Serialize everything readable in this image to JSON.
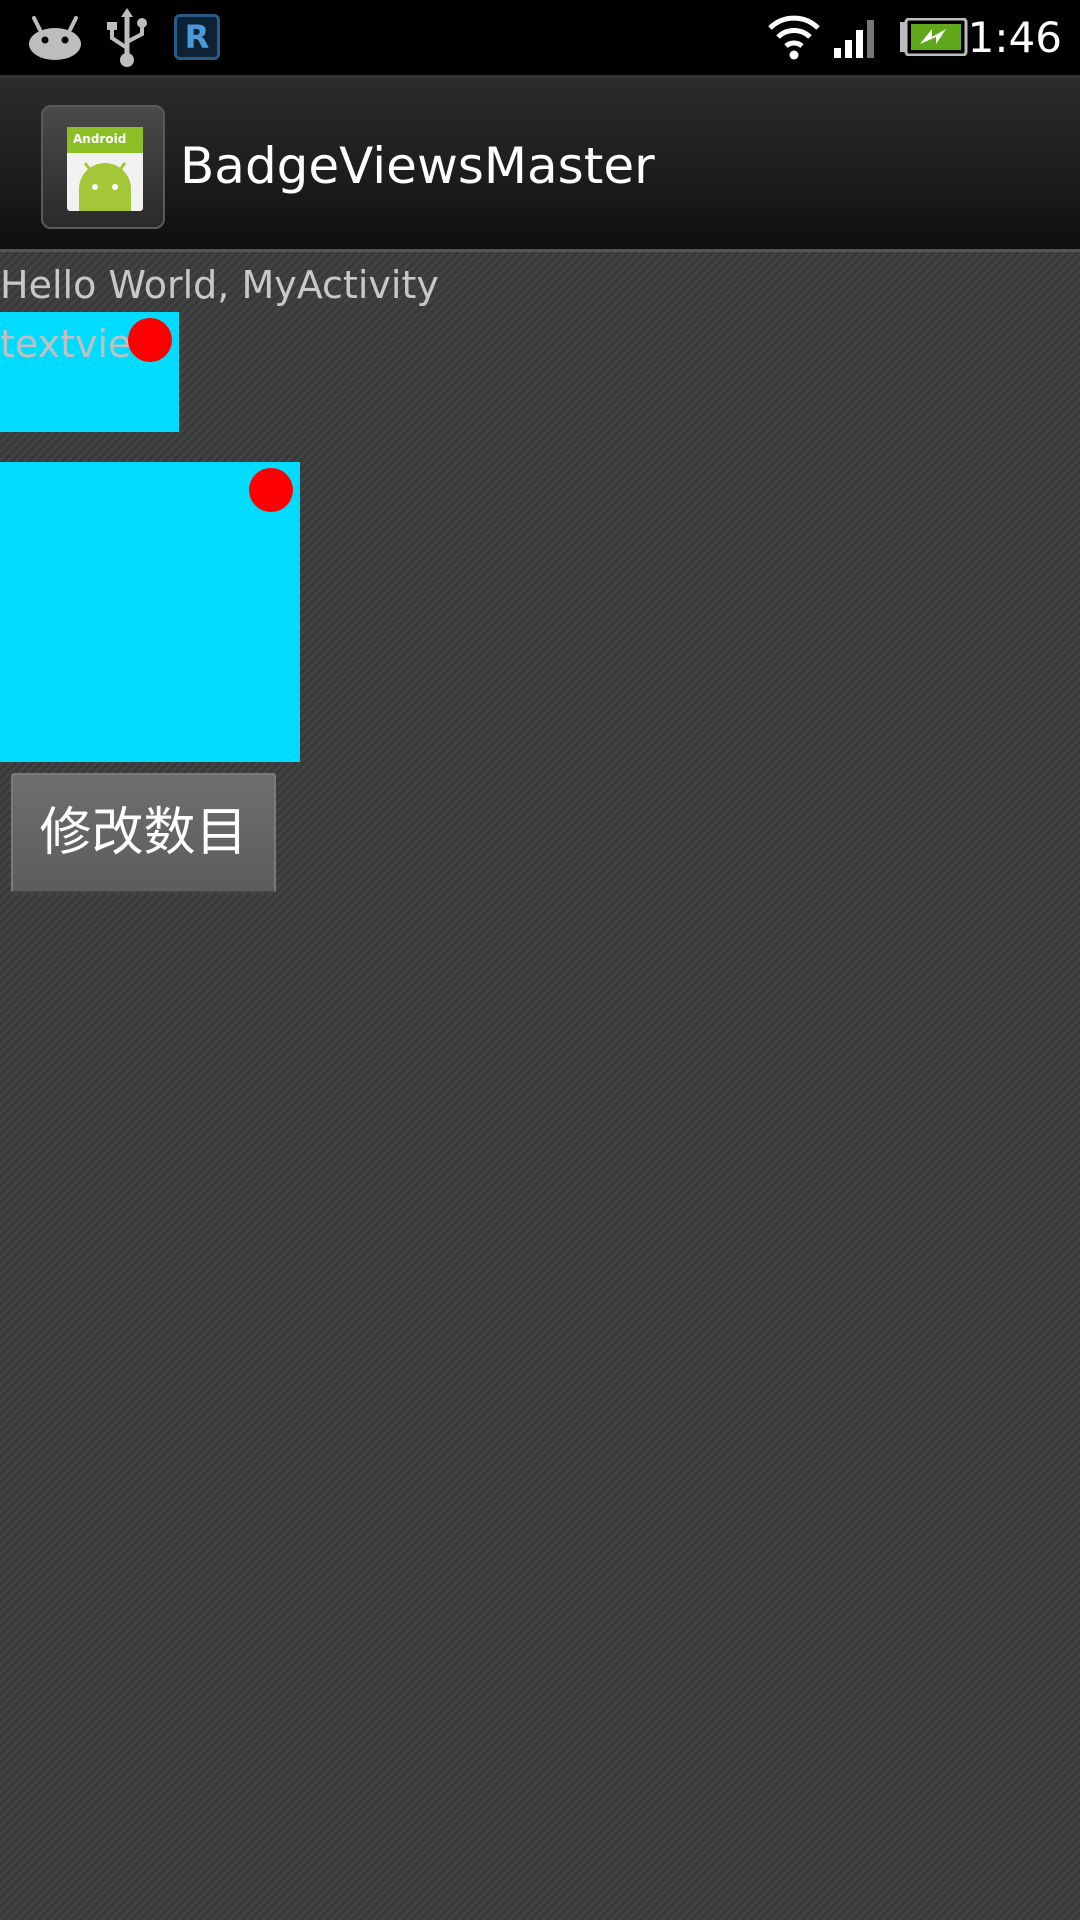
{
  "status_bar": {
    "time": "1:46",
    "left_icons": [
      "android-notification-icon",
      "usb-icon",
      "r-app-icon"
    ],
    "r_icon_letter": "R",
    "right_icons": [
      "wifi-icon",
      "signal-icon",
      "battery-charging-icon"
    ]
  },
  "action_bar": {
    "app_icon": "android-app-icon",
    "app_icon_text": "Android",
    "title": "BadgeViewsMaster"
  },
  "content": {
    "hello_text": "Hello World, MyActivity",
    "textview_label": "textview",
    "modify_button_label": "修改数目"
  },
  "colors": {
    "background": "#3b3c3c",
    "badge_target": "#00dcff",
    "badge": "#ff0000",
    "button": "#666666"
  }
}
